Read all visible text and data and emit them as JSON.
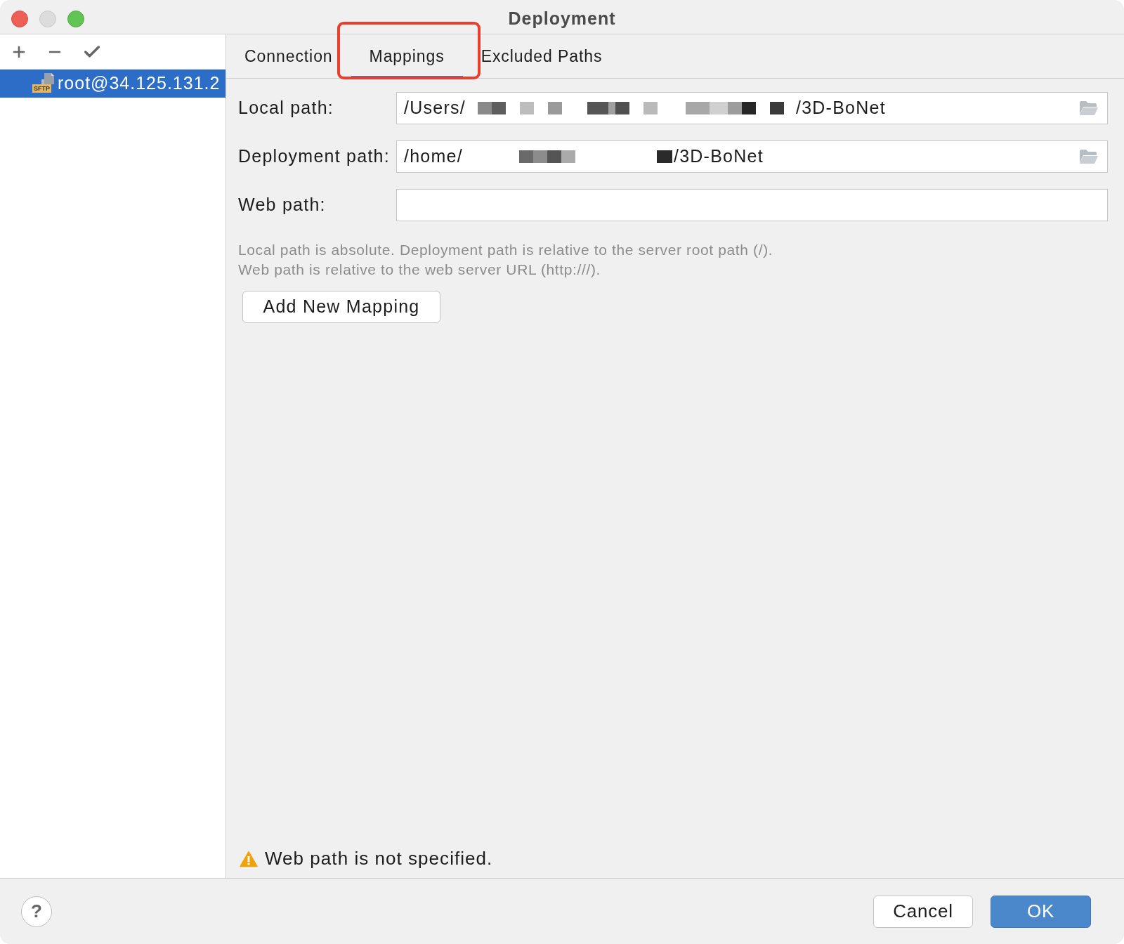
{
  "window": {
    "title": "Deployment"
  },
  "sidebar": {
    "items": [
      {
        "label": "root@34.125.131.2",
        "badge": "SFTP",
        "selected": true
      }
    ]
  },
  "tabs": [
    {
      "label": "Connection",
      "selected": false,
      "highlighted": false
    },
    {
      "label": "Mappings",
      "selected": true,
      "highlighted": true
    },
    {
      "label": "Excluded Paths",
      "selected": false,
      "highlighted": false
    }
  ],
  "mappings": {
    "fields": [
      {
        "kind": "browse",
        "label": "Local path:",
        "value_start": "/Users/",
        "redacted": true,
        "value_end": "/3D-BoNet"
      },
      {
        "kind": "browse",
        "label": "Deployment path:",
        "value_start": "/home/",
        "redacted": true,
        "value_end": "/3D-BoNet"
      },
      {
        "kind": "text",
        "label": "Web path:"
      }
    ],
    "hints": [
      "Local path is absolute. Deployment path is relative to the server root path (/).",
      "Web path is relative to the web server URL (http:///)."
    ],
    "add_button": "Add New Mapping"
  },
  "warning": {
    "text": "Web path is not specified."
  },
  "footer": {
    "help_button": "?",
    "buttons": [
      {
        "label": "Cancel",
        "kind": "default"
      },
      {
        "label": "OK",
        "kind": "primary"
      }
    ]
  }
}
